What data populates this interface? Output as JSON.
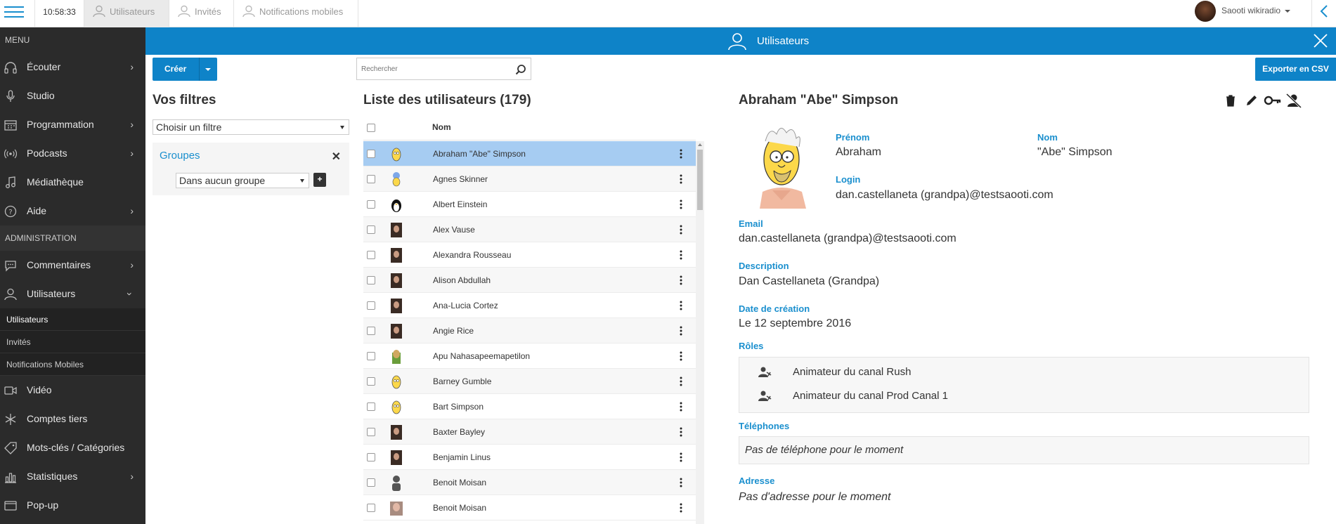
{
  "topbar": {
    "time": "10:58:33",
    "tabs": [
      {
        "label": "Utilisateurs"
      },
      {
        "label": "Invités"
      },
      {
        "label": "Notifications mobiles"
      }
    ],
    "user_name": "Saooti wikiradio"
  },
  "sidebar": {
    "menu_title": "MENU",
    "admin_title": "ADMINISTRATION",
    "menu_items": [
      {
        "label": "Écouter",
        "icon": "headphones-icon",
        "has_arrow": true
      },
      {
        "label": "Studio",
        "icon": "microphone-icon",
        "has_arrow": false
      },
      {
        "label": "Programmation",
        "icon": "calendar-icon",
        "has_arrow": true
      },
      {
        "label": "Podcasts",
        "icon": "broadcast-icon",
        "has_arrow": true
      },
      {
        "label": "Médiathèque",
        "icon": "music-note-icon",
        "has_arrow": false
      },
      {
        "label": "Aide",
        "icon": "help-icon",
        "has_arrow": true
      }
    ],
    "admin_items": [
      {
        "label": "Commentaires",
        "icon": "comment-icon",
        "has_arrow": true
      },
      {
        "label": "Utilisateurs",
        "icon": "user-icon",
        "expanded": true
      }
    ],
    "sub_items": [
      {
        "label": "Utilisateurs",
        "active": true
      },
      {
        "label": "Invités",
        "active": false
      },
      {
        "label": "Notifications Mobiles",
        "active": false
      }
    ],
    "bottom_items": [
      {
        "label": "Vidéo",
        "icon": "video-icon",
        "has_arrow": false
      },
      {
        "label": "Comptes tiers",
        "icon": "snowflake-icon",
        "has_arrow": false
      },
      {
        "label": "Mots-clés / Catégories",
        "icon": "tag-icon",
        "has_arrow": false
      },
      {
        "label": "Statistiques",
        "icon": "bar-chart-icon",
        "has_arrow": true
      },
      {
        "label": "Pop-up",
        "icon": "popup-icon",
        "has_arrow": false
      }
    ]
  },
  "header": {
    "title": "Utilisateurs"
  },
  "toolbar": {
    "create_label": "Créer",
    "search_placeholder": "Rechercher",
    "export_label": "Exporter en CSV"
  },
  "filters": {
    "title": "Vos filtres",
    "select_value": "Choisir un filtre",
    "groups_label": "Groupes",
    "group_select_value": "Dans aucun groupe",
    "add_label": "+"
  },
  "list": {
    "title": "Liste des utilisateurs (179)",
    "column_name": "Nom",
    "rows": [
      {
        "name": "Abraham \"Abe\" Simpson",
        "selected": true,
        "avatar": "yellow"
      },
      {
        "name": "Agnes Skinner",
        "avatar": "yellow-blue"
      },
      {
        "name": "Albert Einstein",
        "avatar": "penguin"
      },
      {
        "name": "Alex Vause",
        "avatar": "photo"
      },
      {
        "name": "Alexandra Rousseau",
        "avatar": "photo"
      },
      {
        "name": "Alison Abdullah",
        "avatar": "photo"
      },
      {
        "name": "Ana-Lucia Cortez",
        "avatar": "photo"
      },
      {
        "name": "Angie Rice",
        "avatar": "photo"
      },
      {
        "name": "Apu Nahasapeemapetilon",
        "avatar": "green"
      },
      {
        "name": "Barney Gumble",
        "avatar": "yellow"
      },
      {
        "name": "Bart Simpson",
        "avatar": "yellow"
      },
      {
        "name": "Baxter Bayley",
        "avatar": "photo"
      },
      {
        "name": "Benjamin Linus",
        "avatar": "photo"
      },
      {
        "name": "Benoit Moisan",
        "avatar": "silhouette"
      },
      {
        "name": "Benoit Moisan",
        "avatar": "photo-light"
      }
    ]
  },
  "detail": {
    "title": "Abraham \"Abe\" Simpson",
    "firstname_label": "Prénom",
    "firstname": "Abraham",
    "lastname_label": "Nom",
    "lastname": "\"Abe\" Simpson",
    "login_label": "Login",
    "login": "dan.castellaneta (grandpa)@testsaooti.com",
    "email_label": "Email",
    "email": "dan.castellaneta (grandpa)@testsaooti.com",
    "description_label": "Description",
    "description": "Dan Castellaneta (Grandpa)",
    "created_label": "Date de création",
    "created": "Le 12 septembre 2016",
    "roles_label": "Rôles",
    "roles": [
      "Animateur du canal Rush",
      "Animateur du canal Prod Canal 1"
    ],
    "phones_label": "Téléphones",
    "phones_empty": "Pas de téléphone pour le moment",
    "address_label": "Adresse",
    "address_empty": "Pas d'adresse pour le moment"
  },
  "colors": {
    "accent": "#0e83c8",
    "sidebar_bg": "#2b2b2b",
    "selected_row": "#a6ccf2",
    "label_blue": "#1a8fce"
  }
}
